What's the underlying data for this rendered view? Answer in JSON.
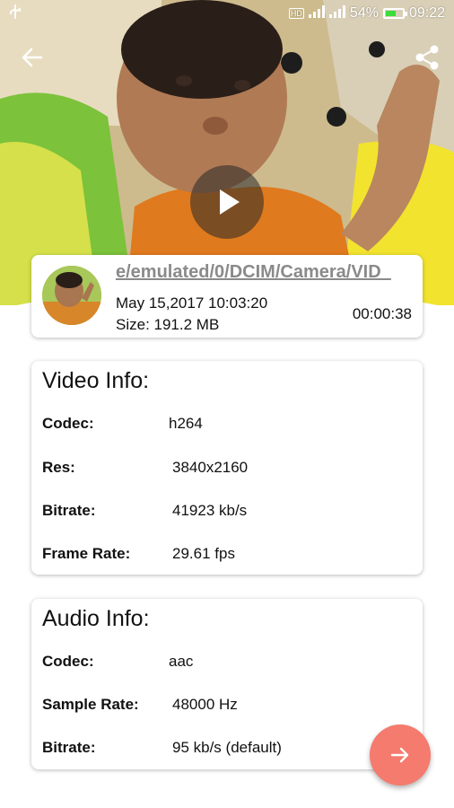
{
  "status_bar": {
    "usb_icon": "usb-icon",
    "network_badge": "HD",
    "battery_percent": "54%",
    "battery_level": 0.54,
    "time": "09:22"
  },
  "file": {
    "path": "e/emulated/0/DCIM/Camera/VID_",
    "date": "May 15,2017 10:03:20",
    "size": "Size: 191.2 MB",
    "duration": "00:00:38"
  },
  "video_info": {
    "title": "Video Info:",
    "rows": [
      {
        "label": "Codec:",
        "value": "h264"
      },
      {
        "label": "Res:",
        "value": "3840x2160"
      },
      {
        "label": "Bitrate:",
        "value": "41923 kb/s"
      },
      {
        "label": "Frame Rate:",
        "value": "29.61 fps"
      }
    ]
  },
  "audio_info": {
    "title": "Audio Info:",
    "rows": [
      {
        "label": "Codec:",
        "value": "aac"
      },
      {
        "label": "Sample Rate:",
        "value": "48000 Hz"
      },
      {
        "label": "Bitrate:",
        "value": "95 kb/s (default)"
      }
    ]
  },
  "colors": {
    "fab": "#f47b6e",
    "battery_fill": "#3cdc3c",
    "path_text": "#8a8a8a"
  },
  "icons": {
    "back": "arrow-left-icon",
    "share": "share-icon",
    "play": "play-icon",
    "fab": "arrow-right-icon"
  }
}
